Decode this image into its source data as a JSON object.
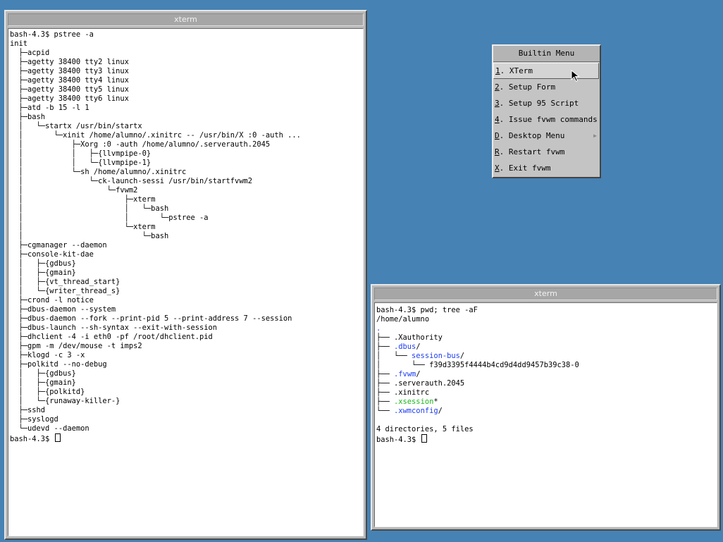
{
  "left_xterm": {
    "title": "xterm",
    "lines": [
      {
        "text": "bash-4.3$ pstree -a"
      },
      {
        "text": "init"
      },
      {
        "text": "  ├─acpid"
      },
      {
        "text": "  ├─agetty 38400 tty2 linux"
      },
      {
        "text": "  ├─agetty 38400 tty3 linux"
      },
      {
        "text": "  ├─agetty 38400 tty4 linux"
      },
      {
        "text": "  ├─agetty 38400 tty5 linux"
      },
      {
        "text": "  ├─agetty 38400 tty6 linux"
      },
      {
        "text": "  ├─atd -b 15 -l 1"
      },
      {
        "text": "  ├─bash"
      },
      {
        "text": "  │   └─startx /usr/bin/startx"
      },
      {
        "text": "  │       └─xinit /home/alumno/.xinitrc -- /usr/bin/X :0 -auth ..."
      },
      {
        "text": "  │           ├─Xorg :0 -auth /home/alumno/.serverauth.2045"
      },
      {
        "text": "  │           │   ├─{llvmpipe-0}"
      },
      {
        "text": "  │           │   └─{llvmpipe-1}"
      },
      {
        "text": "  │           └─sh /home/alumno/.xinitrc"
      },
      {
        "text": "  │               └─ck-launch-sessi /usr/bin/startfvwm2"
      },
      {
        "text": "  │                   └─fvwm2"
      },
      {
        "text": "  │                       ├─xterm"
      },
      {
        "text": "  │                       │   └─bash"
      },
      {
        "text": "  │                       │       └─pstree -a"
      },
      {
        "text": "  │                       └─xterm"
      },
      {
        "text": "  │                           └─bash"
      },
      {
        "text": "  ├─cgmanager --daemon"
      },
      {
        "text": "  ├─console-kit-dae"
      },
      {
        "text": "  │   ├─{gdbus}"
      },
      {
        "text": "  │   ├─{gmain}"
      },
      {
        "text": "  │   ├─{vt_thread_start}"
      },
      {
        "text": "  │   └─{writer_thread_s}"
      },
      {
        "text": "  ├─crond -l notice"
      },
      {
        "text": "  ├─dbus-daemon --system"
      },
      {
        "text": "  ├─dbus-daemon --fork --print-pid 5 --print-address 7 --session"
      },
      {
        "text": "  ├─dbus-launch --sh-syntax --exit-with-session"
      },
      {
        "text": "  ├─dhclient -4 -i eth0 -pf /root/dhclient.pid"
      },
      {
        "text": "  ├─gpm -m /dev/mouse -t imps2"
      },
      {
        "text": "  ├─klogd -c 3 -x"
      },
      {
        "text": "  ├─polkitd --no-debug"
      },
      {
        "text": "  │   ├─{gdbus}"
      },
      {
        "text": "  │   ├─{gmain}"
      },
      {
        "text": "  │   ├─{polkitd}"
      },
      {
        "text": "  │   └─{runaway-killer-}"
      },
      {
        "text": "  ├─sshd"
      },
      {
        "text": "  ├─syslogd"
      },
      {
        "text": "  └─udevd --daemon"
      }
    ],
    "prompt": "bash-4.3$ "
  },
  "right_xterm": {
    "title": "xterm",
    "lines": [
      {
        "segments": [
          {
            "text": "bash-4.3$ pwd; tree -aF"
          }
        ]
      },
      {
        "segments": [
          {
            "text": "/home/alumno"
          }
        ]
      },
      {
        "segments": [
          {
            "text": ".",
            "color": "blue"
          }
        ]
      },
      {
        "segments": [
          {
            "text": "├── .Xauthority"
          }
        ]
      },
      {
        "segments": [
          {
            "text": "├── "
          },
          {
            "text": ".dbus",
            "color": "blue"
          },
          {
            "text": "/"
          }
        ]
      },
      {
        "segments": [
          {
            "text": "│   └── "
          },
          {
            "text": "session-bus",
            "color": "blue"
          },
          {
            "text": "/"
          }
        ]
      },
      {
        "segments": [
          {
            "text": "│       └── f39d3395f4444b4cd9d4dd9457b39c38-0"
          }
        ]
      },
      {
        "segments": [
          {
            "text": "├── "
          },
          {
            "text": ".fvwm",
            "color": "blue"
          },
          {
            "text": "/"
          }
        ]
      },
      {
        "segments": [
          {
            "text": "├── .serverauth.2045"
          }
        ]
      },
      {
        "segments": [
          {
            "text": "├── .xinitrc"
          }
        ]
      },
      {
        "segments": [
          {
            "text": "├── "
          },
          {
            "text": ".xsession",
            "color": "green"
          },
          {
            "text": "*"
          }
        ]
      },
      {
        "segments": [
          {
            "text": "└── "
          },
          {
            "text": ".xwmconfig",
            "color": "blue"
          },
          {
            "text": "/"
          }
        ]
      },
      {
        "segments": [
          {
            "text": ""
          }
        ]
      },
      {
        "segments": [
          {
            "text": "4 directories, 5 files"
          }
        ]
      }
    ],
    "prompt": "bash-4.3$ "
  },
  "builtin_menu": {
    "title": "Builtin Menu",
    "items": [
      {
        "key": "1",
        "label": ". XTerm",
        "active": true,
        "submenu": false
      },
      {
        "key": "2",
        "label": ". Setup Form",
        "active": false,
        "submenu": false
      },
      {
        "key": "3",
        "label": ". Setup 95 Script",
        "active": false,
        "submenu": false
      },
      {
        "key": "4",
        "label": ". Issue fvwm commands",
        "active": false,
        "submenu": false
      },
      {
        "key": "D",
        "label": ". Desktop Menu",
        "active": false,
        "submenu": true
      },
      {
        "key": "R",
        "label": ". Restart fvwm",
        "active": false,
        "submenu": false
      },
      {
        "key": "X",
        "label": ". Exit fvwm",
        "active": false,
        "submenu": false
      }
    ],
    "submenu_arrow_icon": "triangle-right-icon"
  },
  "colors": {
    "desktop": "#4682b4",
    "dir_blue": "#1c3cf0",
    "exec_green": "#18b818"
  }
}
